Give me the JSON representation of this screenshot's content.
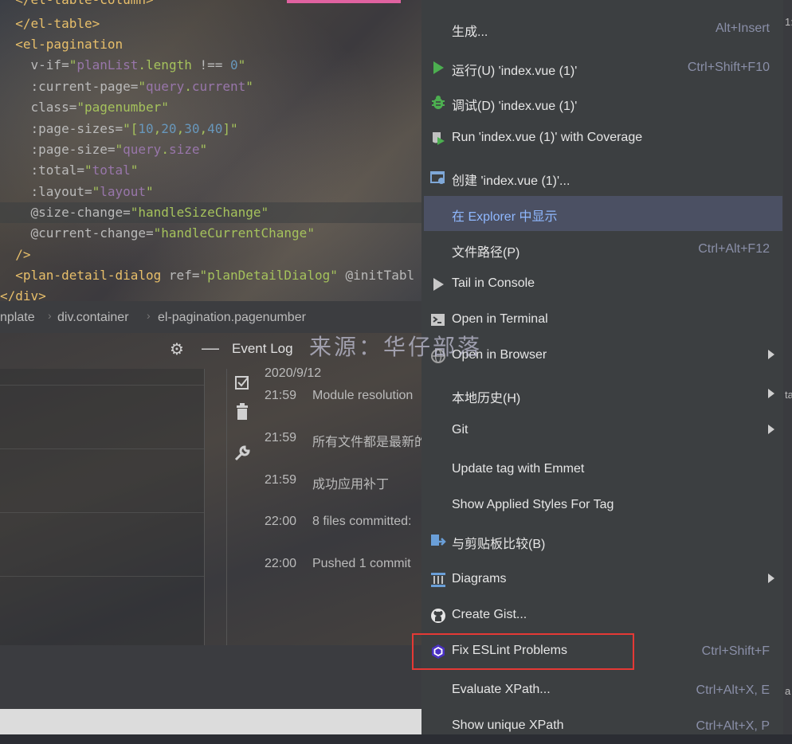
{
  "editor": {
    "lines": [
      {
        "parts": [
          [
            "tag",
            "  </el-table-column>"
          ]
        ]
      },
      {
        "parts": [
          [
            "tag",
            "  </el-table>"
          ]
        ]
      },
      {
        "parts": [
          [
            "tag",
            "  <el-pagination"
          ]
        ]
      },
      {
        "parts": [
          [
            "attr",
            "    v-if="
          ],
          [
            "str",
            "\""
          ],
          [
            "var",
            "planList"
          ],
          [
            "str",
            ".length "
          ],
          [
            "attr",
            "!== "
          ],
          [
            "num",
            "0"
          ],
          [
            "str",
            "\""
          ]
        ]
      },
      {
        "parts": [
          [
            "attr",
            "    :current-page="
          ],
          [
            "str",
            "\""
          ],
          [
            "var",
            "query"
          ],
          [
            "str",
            "."
          ],
          [
            "var",
            "current"
          ],
          [
            "str",
            "\""
          ]
        ]
      },
      {
        "parts": [
          [
            "attr",
            "    class="
          ],
          [
            "str",
            "\"pagenumber\""
          ]
        ]
      },
      {
        "parts": [
          [
            "attr",
            "    :page-sizes="
          ],
          [
            "str",
            "\"["
          ],
          [
            "num",
            "10"
          ],
          [
            "str",
            ","
          ],
          [
            "num",
            "20"
          ],
          [
            "str",
            ","
          ],
          [
            "num",
            "30"
          ],
          [
            "str",
            ","
          ],
          [
            "num",
            "40"
          ],
          [
            "str",
            "]\""
          ]
        ]
      },
      {
        "parts": [
          [
            "attr",
            "    :page-size="
          ],
          [
            "str",
            "\""
          ],
          [
            "var",
            "query"
          ],
          [
            "str",
            "."
          ],
          [
            "var",
            "size"
          ],
          [
            "str",
            "\""
          ]
        ]
      },
      {
        "parts": [
          [
            "attr",
            "    :total="
          ],
          [
            "str",
            "\""
          ],
          [
            "var",
            "total"
          ],
          [
            "str",
            "\""
          ]
        ]
      },
      {
        "parts": [
          [
            "attr",
            "    :layout="
          ],
          [
            "str",
            "\""
          ],
          [
            "var",
            "layout"
          ],
          [
            "str",
            "\""
          ]
        ]
      },
      {
        "parts": [
          [
            "attr",
            "    @size-change="
          ],
          [
            "str",
            "\"handleSizeChange\""
          ]
        ]
      },
      {
        "parts": [
          [
            "attr",
            "    @current-change="
          ],
          [
            "str",
            "\"handleCurrentChange\""
          ]
        ]
      },
      {
        "parts": [
          [
            "tag",
            "  />"
          ]
        ]
      },
      {
        "parts": [
          [
            "tag",
            "  <plan-detail-dialog "
          ],
          [
            "attr",
            "ref="
          ],
          [
            "str",
            "\"planDetailDialog\" "
          ],
          [
            "attr",
            "@initTabl"
          ]
        ]
      },
      {
        "parts": [
          [
            "tag",
            "</div>"
          ]
        ]
      }
    ]
  },
  "breadcrumb": {
    "items": [
      "nplate",
      "div.container",
      "el-pagination.pagenumber"
    ]
  },
  "event_log": {
    "title": "Event Log",
    "date": "2020/9/12",
    "entries": [
      {
        "time": "21:59",
        "message": "Module resolution"
      },
      {
        "time": "21:59",
        "message": "所有文件都是最新的"
      },
      {
        "time": "21:59",
        "message": "成功应用补丁"
      },
      {
        "time": "22:00",
        "message": "8 files committed:"
      },
      {
        "time": "22:00",
        "message": "Pushed 1 commit"
      }
    ]
  },
  "watermark": "来源：华仔部落",
  "right_edge": {
    "t1": "1:",
    "t2": "ta",
    "t3": "a"
  },
  "menu": {
    "items": [
      {
        "label": "生成...",
        "shortcut": "Alt+Insert",
        "icon": "none"
      },
      {
        "label": "运行(U) 'index.vue (1)'",
        "shortcut": "Ctrl+Shift+F10",
        "icon": "run-icon"
      },
      {
        "label": "调试(D) 'index.vue (1)'",
        "shortcut": "",
        "icon": "debug-icon"
      },
      {
        "label": "Run 'index.vue (1)' with Coverage",
        "shortcut": "",
        "icon": "coverage-icon"
      },
      {
        "label": "创建 'index.vue (1)'...",
        "shortcut": "",
        "icon": "create-config-icon"
      },
      {
        "label": "在 Explorer 中显示",
        "shortcut": "",
        "icon": "none"
      },
      {
        "label": "文件路径(P)",
        "shortcut": "Ctrl+Alt+F12",
        "icon": "none"
      },
      {
        "label": "Tail in Console",
        "shortcut": "",
        "icon": "tail-icon"
      },
      {
        "label": "Open in Terminal",
        "shortcut": "",
        "icon": "terminal-icon"
      },
      {
        "label": "Open in Browser",
        "shortcut": "",
        "icon": "globe-icon",
        "submenu": true
      },
      {
        "label": "本地历史(H)",
        "shortcut": "",
        "icon": "none",
        "submenu": true
      },
      {
        "label": "Git",
        "shortcut": "",
        "icon": "none",
        "submenu": true
      },
      {
        "label": "Update tag with Emmet",
        "shortcut": "",
        "icon": "none"
      },
      {
        "label": "Show Applied Styles For Tag",
        "shortcut": "",
        "icon": "none"
      },
      {
        "label": "与剪贴板比较(B)",
        "shortcut": "",
        "icon": "compare-icon"
      },
      {
        "label": "Diagrams",
        "shortcut": "",
        "icon": "diagrams-icon",
        "submenu": true
      },
      {
        "label": "Create Gist...",
        "shortcut": "",
        "icon": "github-icon"
      },
      {
        "label": "Fix ESLint Problems",
        "shortcut": "Ctrl+Shift+F",
        "icon": "eslint-icon"
      },
      {
        "label": "Evaluate XPath...",
        "shortcut": "Ctrl+Alt+X, E",
        "icon": "none"
      },
      {
        "label": "Show unique XPath",
        "shortcut": "Ctrl+Alt+X, P",
        "icon": "none"
      }
    ],
    "selected_index": 5,
    "highlighted_label": "Fix ESLint Problems"
  },
  "colors": {
    "menu_bg": "#3c3f41",
    "selected_bg": "#4b5063",
    "highlight_border": "#e53935",
    "run_green": "#4caf50"
  }
}
